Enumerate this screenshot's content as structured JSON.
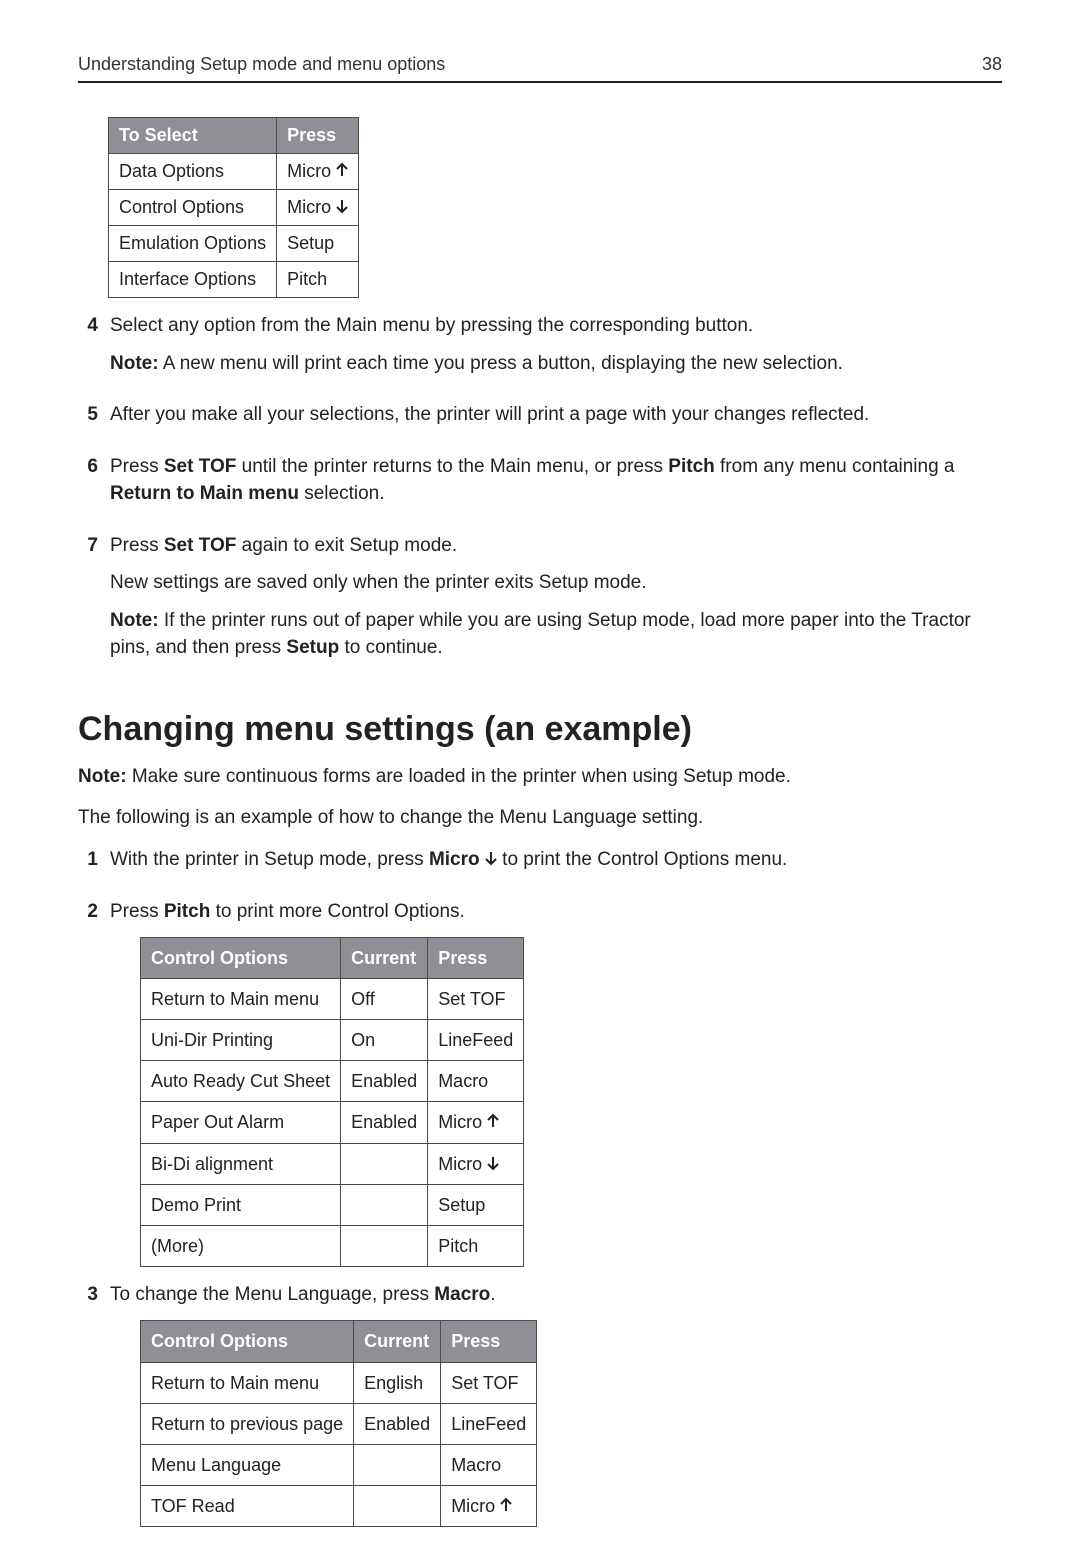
{
  "header": {
    "title": "Understanding Setup mode and menu options",
    "page_number": "38"
  },
  "table1": {
    "headers": [
      "To Select",
      "Press"
    ],
    "rows": [
      {
        "option": "Data Options",
        "press_kind": "micro_up"
      },
      {
        "option": "Control Options",
        "press_kind": "micro_down"
      },
      {
        "option": "Emulation Options",
        "press_kind": "text",
        "press": "Setup"
      },
      {
        "option": "Interface Options",
        "press_kind": "text",
        "press": "Pitch"
      }
    ]
  },
  "steps_a": {
    "items": [
      {
        "num": "4",
        "paras": [
          {
            "text": "Select any option from the Main menu by pressing the corresponding button."
          },
          {
            "prefix_bold": "Note:",
            "text": " A new menu will print each time you press a button, displaying the new selection."
          }
        ]
      },
      {
        "num": "5",
        "paras": [
          {
            "text": "After you make all your selections, the printer will print a page with your changes reflected."
          }
        ]
      },
      {
        "num": "6",
        "paras": [
          {
            "segments": [
              {
                "t": "Press "
              },
              {
                "t": "Set TOF",
                "b": true
              },
              {
                "t": " until the printer returns to the Main menu, or press "
              },
              {
                "t": "Pitch",
                "b": true
              },
              {
                "t": " from any menu containing a "
              },
              {
                "t": "Return to Main menu",
                "b": true
              },
              {
                "t": " selection."
              }
            ]
          }
        ]
      },
      {
        "num": "7",
        "paras": [
          {
            "segments": [
              {
                "t": "Press "
              },
              {
                "t": "Set TOF",
                "b": true
              },
              {
                "t": " again to exit Setup mode."
              }
            ]
          },
          {
            "text": "New settings are saved only when the printer exits Setup mode."
          },
          {
            "segments": [
              {
                "t": "Note:",
                "b": true
              },
              {
                "t": " If the printer runs out of paper while you are using Setup mode, load more paper into the Tractor pins, and then press "
              },
              {
                "t": "Setup",
                "b": true
              },
              {
                "t": " to continue."
              }
            ]
          }
        ]
      }
    ]
  },
  "section_heading": "Changing menu settings (an example)",
  "intro_note": {
    "segments": [
      {
        "t": "Note:",
        "b": true
      },
      {
        "t": " Make sure continuous forms are loaded in the printer when using Setup mode."
      }
    ]
  },
  "intro_line": "The following is an example of how to change the Menu Language setting.",
  "steps_b": {
    "items": [
      {
        "num": "1",
        "paras": [
          {
            "segments": [
              {
                "t": "With the printer in Setup mode, press "
              },
              {
                "t": "Micro ",
                "b": true
              },
              {
                "arrow": "down",
                "b": true
              },
              {
                "t": " to print the Control Options menu."
              }
            ]
          }
        ]
      },
      {
        "num": "2",
        "paras": [
          {
            "segments": [
              {
                "t": "Press "
              },
              {
                "t": "Pitch",
                "b": true
              },
              {
                "t": " to print more Control Options."
              }
            ]
          }
        ],
        "table": "table2"
      },
      {
        "num": "3",
        "paras": [
          {
            "segments": [
              {
                "t": "To change the Menu Language, press "
              },
              {
                "t": "Macro",
                "b": true
              },
              {
                "t": "."
              }
            ]
          }
        ],
        "table": "table3"
      }
    ]
  },
  "table2": {
    "headers": [
      "Control Options",
      "Current",
      "Press"
    ],
    "rows": [
      {
        "c0": "Return to Main menu",
        "c1": "Off",
        "press_kind": "text",
        "press": "Set TOF"
      },
      {
        "c0": "Uni-Dir Printing",
        "c1": "On",
        "press_kind": "text",
        "press": "LineFeed"
      },
      {
        "c0": "Auto Ready Cut Sheet",
        "c1": "Enabled",
        "press_kind": "text",
        "press": "Macro"
      },
      {
        "c0": "Paper Out Alarm",
        "c1": "Enabled",
        "press_kind": "micro_up"
      },
      {
        "c0": "Bi-Di alignment",
        "c1": "",
        "press_kind": "micro_down"
      },
      {
        "c0": "Demo Print",
        "c1": "",
        "press_kind": "text",
        "press": "Setup"
      },
      {
        "c0": "(More)",
        "c1": "",
        "press_kind": "text",
        "press": "Pitch"
      }
    ]
  },
  "table3": {
    "headers": [
      "Control Options",
      "Current",
      "Press"
    ],
    "rows": [
      {
        "c0": "Return to Main menu",
        "c1": "English",
        "press_kind": "text",
        "press": "Set TOF"
      },
      {
        "c0": "Return to previous page",
        "c1": "Enabled",
        "press_kind": "text",
        "press": "LineFeed"
      },
      {
        "c0": "Menu Language",
        "c1": "",
        "press_kind": "text",
        "press": "Macro"
      },
      {
        "c0": "TOF Read",
        "c1": "",
        "press_kind": "micro_up"
      }
    ]
  },
  "labels": {
    "micro": "Micro "
  }
}
